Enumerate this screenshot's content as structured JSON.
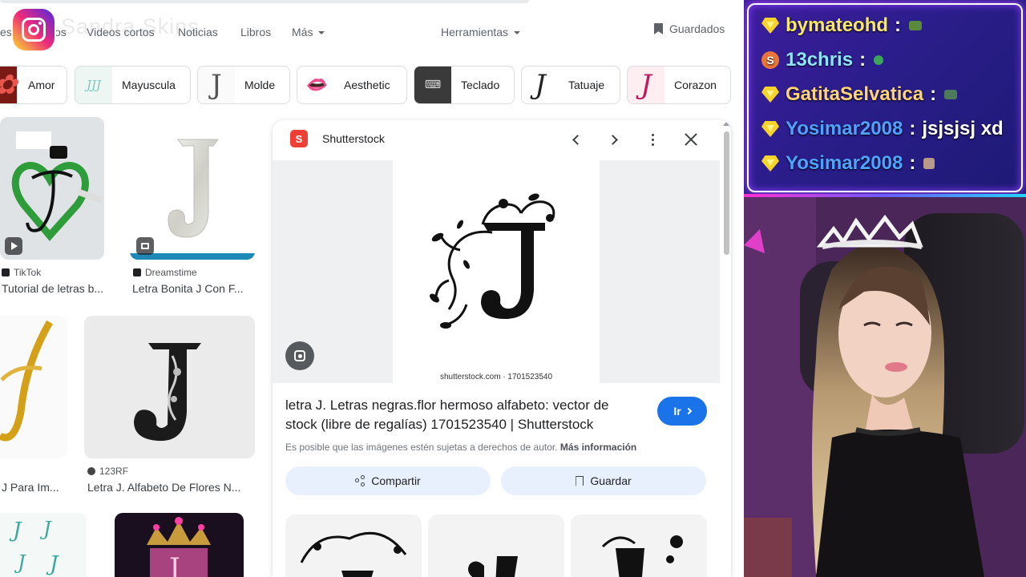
{
  "header": {
    "tabs": [
      "es",
      "os",
      "Videos cortos",
      "Noticias",
      "Libros",
      "Más",
      "Herramientas"
    ],
    "saved_label": "Guardados",
    "watermark": "Sandra Skins"
  },
  "chips": [
    {
      "label": "Amor",
      "icon": "rose-icon"
    },
    {
      "label": "Mayuscula",
      "icon": "letters-icon"
    },
    {
      "label": "Molde",
      "icon": "letter-j-icon"
    },
    {
      "label": "Aesthetic",
      "icon": "lips-icon"
    },
    {
      "label": "Teclado",
      "icon": "keyboard-icon"
    },
    {
      "label": "Tatuaje",
      "icon": "tattoo-j-icon"
    },
    {
      "label": "Corazon",
      "icon": "heart-j-icon"
    }
  ],
  "results": [
    {
      "source": "TikTok",
      "caption": "Tutorial de letras b..."
    },
    {
      "source": "Dreamstime",
      "caption": "Letra Bonita J Con F..."
    },
    {
      "source": "",
      "caption": "J Para Im..."
    },
    {
      "source": "123RF",
      "caption": "Letra J. Alfabeto De Flores N..."
    }
  ],
  "panel": {
    "source": "Shutterstock",
    "image_watermark": "shutterstock.com · 1701523540",
    "title_line1": "letra J. Letras negras.flor hermoso alfabeto: vector de",
    "title_line2": "stock (libre de regalías) 1701523540 | Shutterstock",
    "go_label": "Ir",
    "copyright_text": "Es posible que las imágenes estén sujetas a derechos de autor.",
    "more_info": "Más información",
    "share_label": "Compartir",
    "save_label": "Guardar"
  },
  "chat": [
    {
      "user": "bymateohd",
      "message": "",
      "badge": "gem",
      "user_color": "#f7e86a"
    },
    {
      "user": "13chris",
      "message": "",
      "badge": "coin",
      "user_color": "#8fe3ff"
    },
    {
      "user": "GatitaSelvatica",
      "message": "",
      "badge": "gem",
      "user_color": "#ffd37a"
    },
    {
      "user": "Yosimar2008",
      "message": "jsjsjsj xd",
      "badge": "gem",
      "user_color": "#4fa3ff"
    },
    {
      "user": "Yosimar2008",
      "message": "",
      "badge": "gem",
      "user_color": "#4fa3ff"
    }
  ],
  "colors": {
    "accent": "#1a73e8",
    "action_bg": "#e8f0fe",
    "chat_bg": "#2a1d8a"
  }
}
